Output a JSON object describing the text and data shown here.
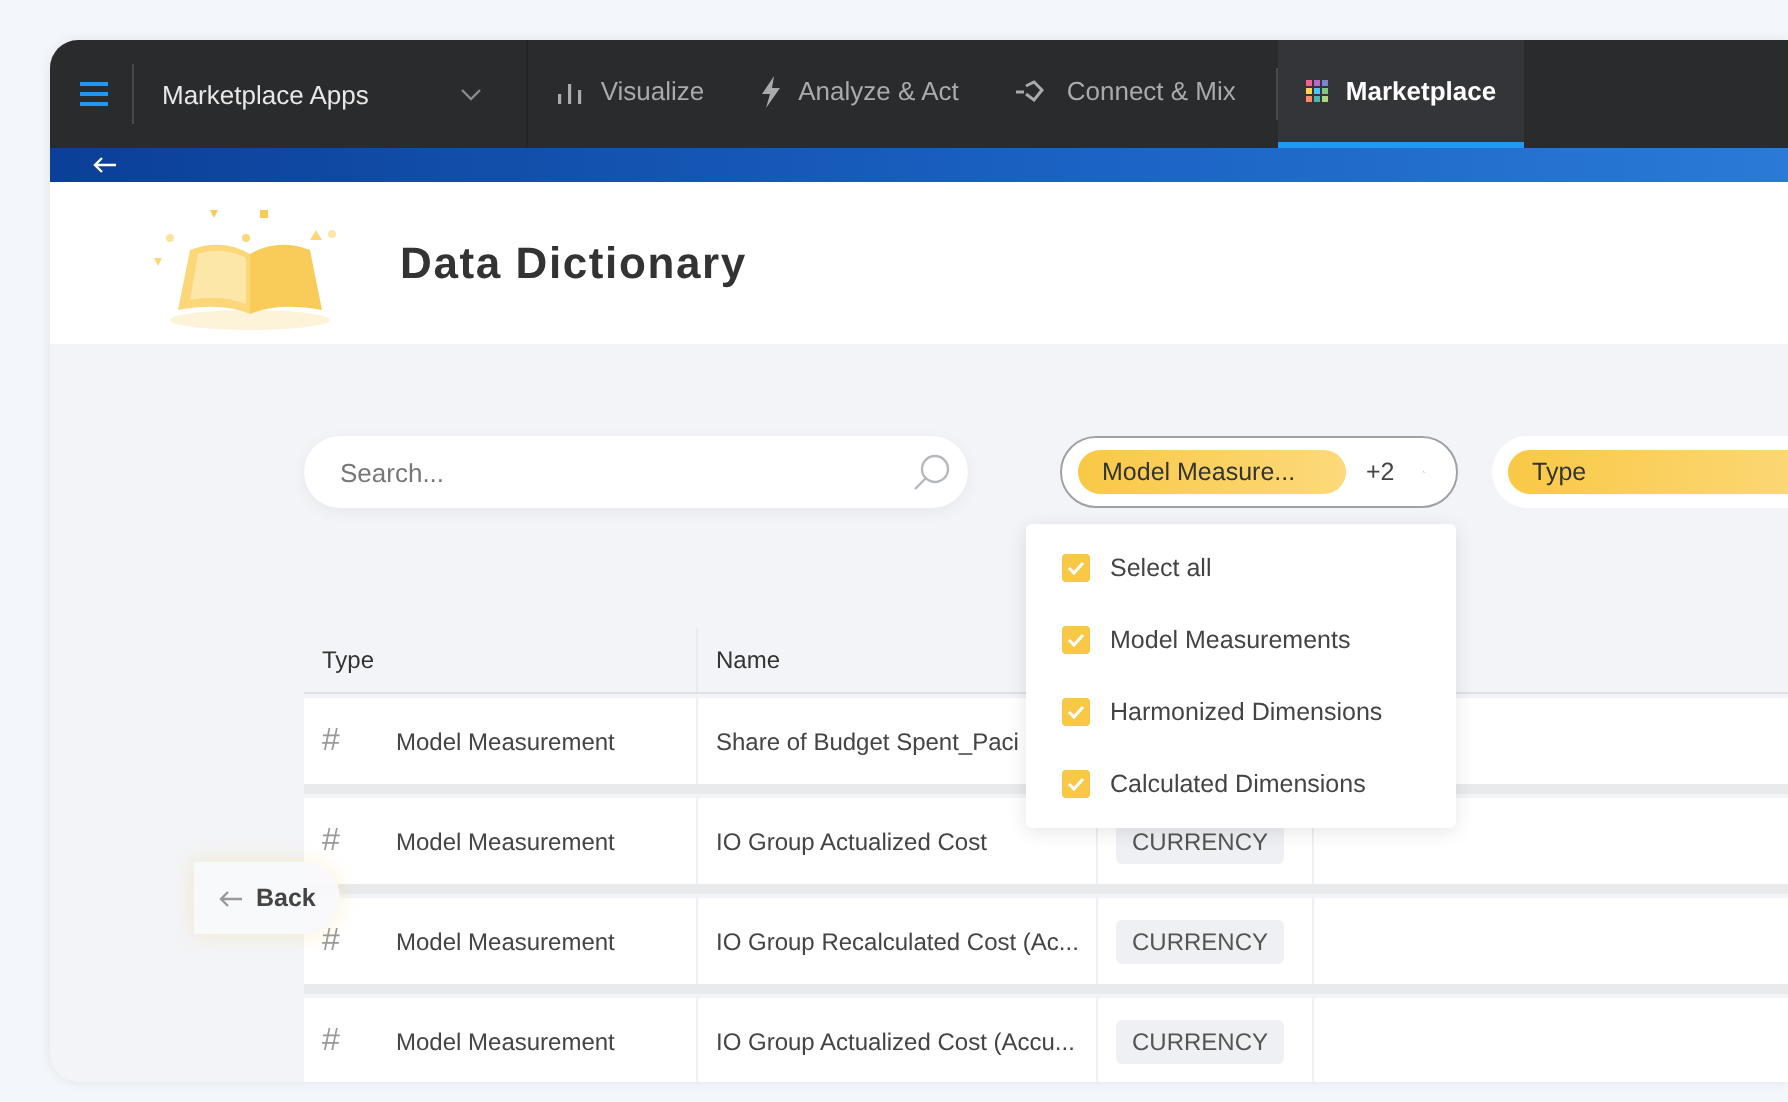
{
  "nav": {
    "app_switcher": "Marketplace Apps",
    "tabs": [
      {
        "label": "Visualize",
        "selected": false
      },
      {
        "label": "Analyze & Act",
        "selected": false
      },
      {
        "label": "Connect & Mix",
        "selected": false
      },
      {
        "label": "Marketplace",
        "selected": true
      }
    ]
  },
  "page": {
    "title": "Data Dictionary"
  },
  "search": {
    "placeholder": "Search..."
  },
  "filters": [
    {
      "label": "Model Measure...",
      "count": "+2",
      "expanded": true
    },
    {
      "label": "Type",
      "expanded": false
    }
  ],
  "dropdown": {
    "options": [
      {
        "label": "Select all",
        "checked": true
      },
      {
        "label": "Model Measurements",
        "checked": true
      },
      {
        "label": "Harmonized Dimensions",
        "checked": true
      },
      {
        "label": "Calculated Dimensions",
        "checked": true
      }
    ]
  },
  "table": {
    "columns": [
      "Type",
      "Name"
    ],
    "rows": [
      {
        "icon": "#",
        "type": "Model Measurement",
        "name": "Share of Budget Spent_Paci"
      },
      {
        "icon": "#",
        "type": "Model Measurement",
        "name": "IO Group Actualized Cost",
        "data_type": "CURRENCY"
      },
      {
        "icon": "#",
        "type": "Model Measurement",
        "name": "IO Group Recalculated Cost (Ac...",
        "data_type": "CURRENCY"
      },
      {
        "icon": "#",
        "type": "Model Measurement",
        "name": "IO Group Actualized Cost (Accu...",
        "data_type": "CURRENCY"
      }
    ]
  },
  "back_button": "Back"
}
